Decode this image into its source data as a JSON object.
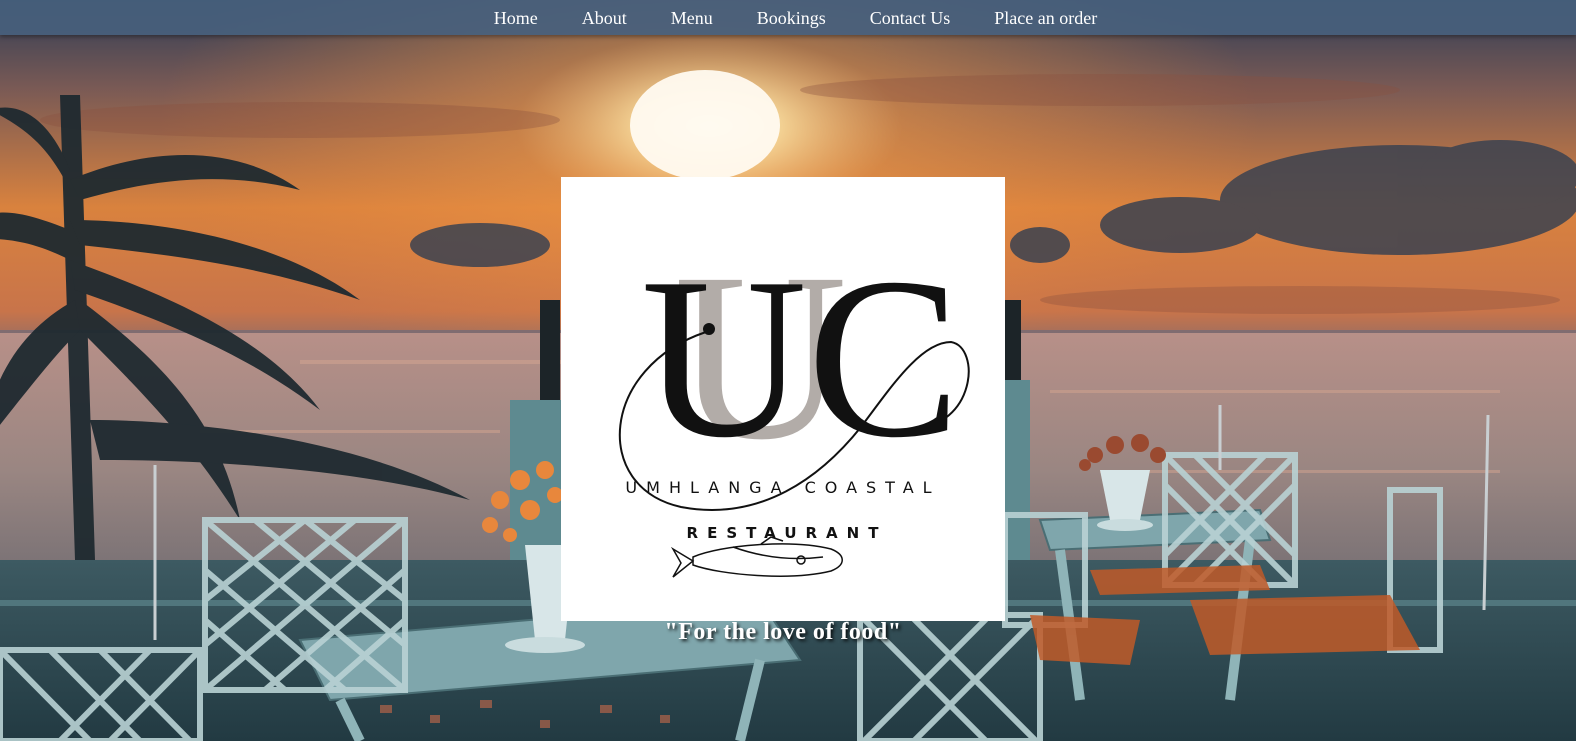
{
  "nav": {
    "items": [
      {
        "label": "Home"
      },
      {
        "label": "About"
      },
      {
        "label": "Menu"
      },
      {
        "label": "Bookings"
      },
      {
        "label": "Contact Us"
      },
      {
        "label": "Place an order"
      }
    ]
  },
  "hero": {
    "background": "sunset-beach-terrace-photo",
    "logo": {
      "monogram": "UC",
      "name": "UMHLANGA COASTAL",
      "subtitle": "RESTAURANT",
      "icon": "fish-icon"
    },
    "tagline": "\"For the love of food\""
  },
  "colors": {
    "nav_bg": "#465f7d",
    "sky_top": "#3a3a4a",
    "sun": "#fff6d8",
    "sunset_orange": "#e8873c",
    "sea": "#8a7a78",
    "terrace": "#2f4a52"
  }
}
